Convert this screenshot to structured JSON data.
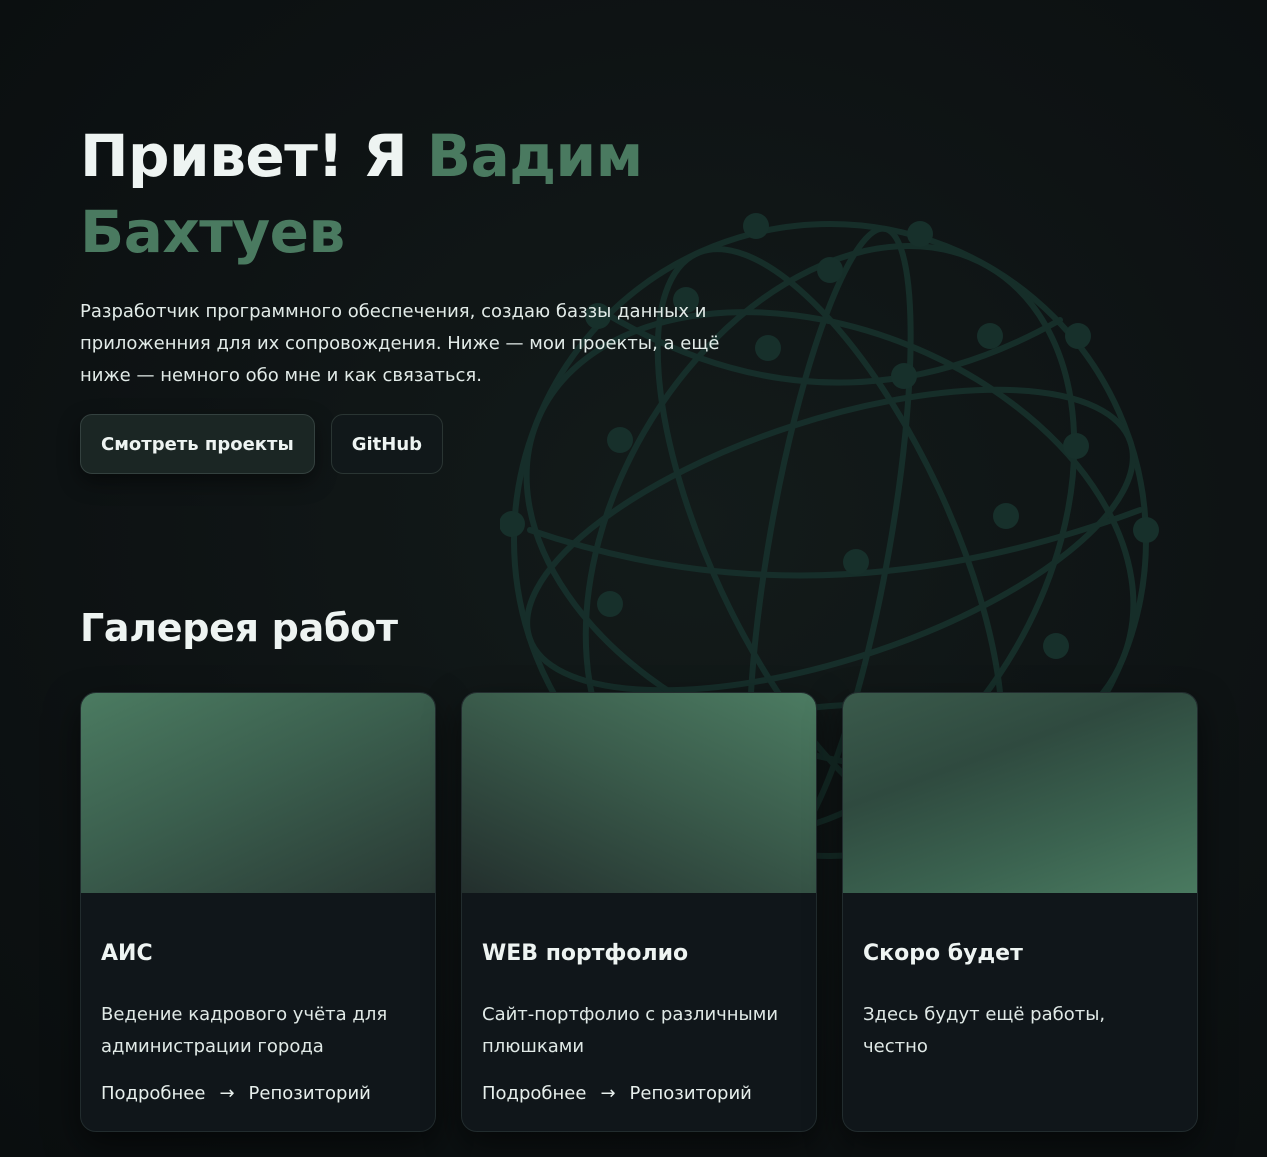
{
  "hero": {
    "greeting": "Привет! Я ",
    "name": "Вадим Бахтуев",
    "description": "Разработчик программного обеспечения, создаю баззы данных и приложенния для их сопровождения. Ниже — мои проекты, а ещё ниже — немного обо мне и как связаться.",
    "primary_button": "Смотреть проекты",
    "secondary_button": "GitHub"
  },
  "gallery": {
    "title": "Галерея работ",
    "cards": [
      {
        "title": "АИС",
        "description": "Ведение кадрового учёта для администрации города",
        "more_link": "Подробнее",
        "arrow": "→",
        "repo_link": "Репозиторий"
      },
      {
        "title": "WEB портфолио",
        "description": "Сайт-портфолио с различными плюшками",
        "more_link": "Подробнее",
        "arrow": "→",
        "repo_link": "Репозиторий"
      },
      {
        "title": "Скоро будет",
        "description": "Здесь будут ещё работы, честно"
      }
    ]
  },
  "colors": {
    "accent": "#4a7a60",
    "background": "#0e1314",
    "card_background": "#10161a",
    "globe_line": "#17302b"
  },
  "decor": {
    "background_icon": "globe-network-icon"
  }
}
